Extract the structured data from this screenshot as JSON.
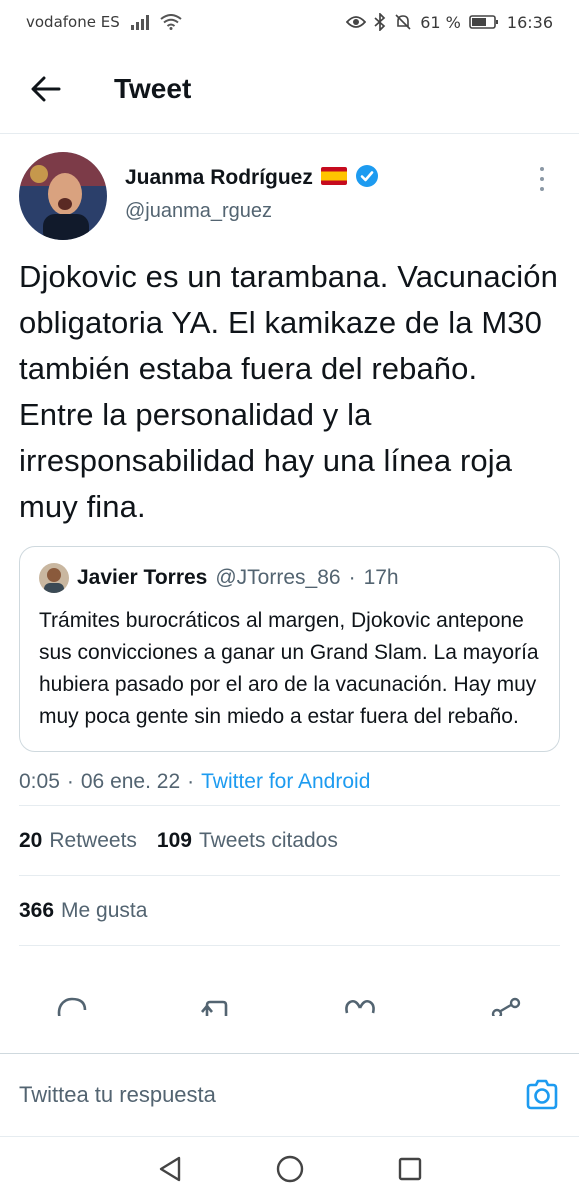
{
  "status_bar": {
    "carrier": "vodafone ES",
    "battery": "61 %",
    "time": "16:36"
  },
  "header": {
    "title": "Tweet"
  },
  "tweet": {
    "author_name": "Juanma Rodríguez",
    "author_flag": "spain-flag",
    "verified": true,
    "handle": "@juanma_rguez",
    "text": "Djokovic es un tarambana. Vacunación obligatoria YA. El kamikaze de la M30 también estaba fuera del rebaño. Entre la personalidad y la irresponsabilidad hay una línea roja muy fina.",
    "quote": {
      "author_name": "Javier Torres",
      "handle": "@JTorres_86",
      "separator": "·",
      "time": "17h",
      "text": "Trámites burocráticos al margen, Djokovic antepone sus convicciones a ganar un Grand Slam. La mayoría hubiera pasado por el aro de la vacunación. Hay muy muy poca gente sin miedo a estar fuera del rebaño."
    },
    "time": "0:05",
    "date": "06 ene. 22",
    "separator": "·",
    "source": "Twitter for Android",
    "retweets_count": "20",
    "retweets_label": "Retweets",
    "quotes_count": "109",
    "quotes_label": "Tweets citados",
    "likes_count": "366",
    "likes_label": "Me gusta"
  },
  "reply": {
    "placeholder": "Twittea tu respuesta"
  },
  "colors": {
    "accent": "#1d9bf0",
    "text_primary": "#0f1419",
    "text_secondary": "#536471",
    "border": "#cfd9de"
  },
  "icons": {
    "back": "arrow-left-icon",
    "more": "more-vertical-icon",
    "verified": "verified-badge-icon",
    "reply": "comment-icon",
    "retweet": "retweet-icon",
    "like": "heart-icon",
    "share": "share-icon",
    "camera": "camera-icon"
  }
}
